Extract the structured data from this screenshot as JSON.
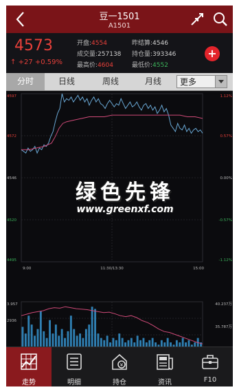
{
  "header": {
    "title": "豆一1501",
    "subtitle": "A1501"
  },
  "quote": {
    "price": "4573",
    "change": "+27",
    "change_pct": "+0.59%",
    "open_label": "开盘:",
    "open_value": "4554",
    "prev_settle_label": "昨结算:",
    "prev_settle_value": "4546",
    "volume_label": "成交量:",
    "volume_value": "257138",
    "open_interest_label": "持仓量:",
    "open_interest_value": "393346",
    "high_label": "最高价:",
    "high_value": "4604",
    "low_label": "最低价:",
    "low_value": "4552"
  },
  "tabs": [
    {
      "label": "分时"
    },
    {
      "label": "日线"
    },
    {
      "label": "周线"
    },
    {
      "label": "月线"
    }
  ],
  "more_select": {
    "value": "更多"
  },
  "chart_data": [
    {
      "type": "line",
      "title": "",
      "x_ticks": [
        "9:00",
        "11:30/13:30",
        "15:00"
      ],
      "y_ticks_left": [
        "4597",
        "4572",
        "4546",
        "4520",
        "4495"
      ],
      "y_ticks_right": [
        "1.12%",
        "0.57%",
        "0.00%",
        "-0.57%",
        "-1.12%"
      ],
      "baseline": 4546,
      "ylim": [
        4495,
        4597
      ],
      "series": [
        {
          "color": "#6aa9d6",
          "x": [
            0,
            3,
            6,
            9,
            12,
            15,
            18,
            21,
            24,
            27,
            30,
            33,
            36,
            39,
            42,
            45,
            48,
            51,
            54,
            57,
            60,
            63,
            66,
            69,
            72,
            75,
            78,
            81,
            84,
            87,
            90,
            93,
            96,
            99,
            102,
            105,
            108,
            111,
            114,
            117,
            120,
            123,
            126,
            129,
            132,
            135,
            138,
            141,
            144,
            147,
            150,
            153,
            156,
            159,
            162,
            165,
            168,
            171,
            174,
            177,
            180,
            183,
            186,
            189,
            192,
            195,
            198,
            201,
            204,
            207,
            210,
            213,
            216,
            219,
            222,
            225,
            228,
            231,
            234,
            237,
            240
          ],
          "values": [
            4563,
            4562,
            4561,
            4564,
            4562,
            4563,
            4565,
            4561,
            4564,
            4563,
            4566,
            4565,
            4567,
            4571,
            4574,
            4580,
            4585,
            4588,
            4597,
            4592,
            4594,
            4593,
            4595,
            4592,
            4594,
            4596,
            4593,
            4595,
            4592,
            4594,
            4590,
            4593,
            4595,
            4592,
            4594,
            4591,
            4590,
            4588,
            4591,
            4593,
            4591,
            4589,
            4591,
            4590,
            4594,
            4591,
            4588,
            4590,
            4592,
            4589,
            4590,
            4592,
            4589,
            4587,
            4590,
            4591,
            4588,
            4590,
            4587,
            4589,
            4585,
            4587,
            4590,
            4586,
            4588,
            4584,
            4578,
            4576,
            4574,
            4579,
            4576,
            4575,
            4578,
            4574,
            4576,
            4573,
            4575,
            4576,
            4574,
            4575,
            4573
          ]
        },
        {
          "color": "#d04a78",
          "x": [
            0,
            10,
            20,
            30,
            40,
            45,
            50,
            55,
            60,
            70,
            80,
            90,
            100,
            110,
            120,
            130,
            140,
            150,
            160,
            170,
            180,
            190,
            200,
            210,
            220,
            230,
            240
          ],
          "values": [
            4563,
            4563,
            4564,
            4565,
            4567,
            4571,
            4576,
            4579,
            4580,
            4581,
            4582,
            4583,
            4583,
            4583,
            4584,
            4584,
            4584,
            4584,
            4584,
            4584,
            4584,
            4584,
            4584,
            4584,
            4583,
            4583,
            4582
          ]
        }
      ]
    },
    {
      "type": "bar",
      "title": "",
      "y_ticks_left": [
        "3.957",
        "2936"
      ],
      "y_ticks_right": [
        "40.237万",
        "35.787万",
        "30.337万"
      ],
      "values": [
        0.55,
        0.4,
        0.8,
        0.6,
        0.35,
        0.5,
        0.9,
        0.45,
        0.3,
        0.7,
        0.4,
        0.6,
        0.35,
        0.5,
        0.3,
        0.45,
        0.8,
        0.5,
        0.35,
        0.4,
        0.3,
        0.5,
        0.6,
        1.0,
        0.95,
        0.4,
        0.3,
        0.25,
        0.35,
        0.2,
        0.3,
        0.25,
        0.4,
        0.3,
        0.2,
        0.25,
        0.3,
        0.2,
        0.35,
        0.25,
        0.3,
        0.2,
        0.25,
        0.3,
        0.2,
        0.15,
        0.25,
        0.2,
        0.3,
        0.2,
        0.15,
        0.25,
        0.2,
        0.3,
        0.2,
        0.25,
        0.15,
        0.2,
        0.3,
        0.2
      ],
      "open_interest_series": {
        "color": "#d04a78",
        "values": [
          0.72,
          0.75,
          0.78,
          0.8,
          0.82,
          0.86,
          0.88,
          0.87,
          0.9,
          0.88,
          0.86,
          0.85,
          0.84,
          0.82,
          0.8,
          0.78,
          0.79,
          0.76,
          0.72,
          0.7,
          0.72,
          0.68,
          0.62,
          0.58,
          0.52,
          0.45,
          0.4,
          0.38,
          0.34,
          0.3,
          0.26,
          0.22,
          0.18,
          0.15
        ]
      }
    }
  ],
  "watermark": {
    "big": "绿色先锋",
    "small": "www.greenxf.com"
  },
  "bottom_nav": [
    {
      "label": "走势",
      "icon": "trend-icon"
    },
    {
      "label": "明细",
      "icon": "list-icon"
    },
    {
      "label": "持仓",
      "icon": "position-icon"
    },
    {
      "label": "资讯",
      "icon": "news-icon"
    },
    {
      "label": "F10",
      "icon": "briefcase-icon"
    }
  ],
  "colors": {
    "header_bg": "#7a1418",
    "up": "#e8403a",
    "down": "#3bb35a",
    "price_line": "#6aa9d6",
    "avg_line": "#d04a78"
  }
}
